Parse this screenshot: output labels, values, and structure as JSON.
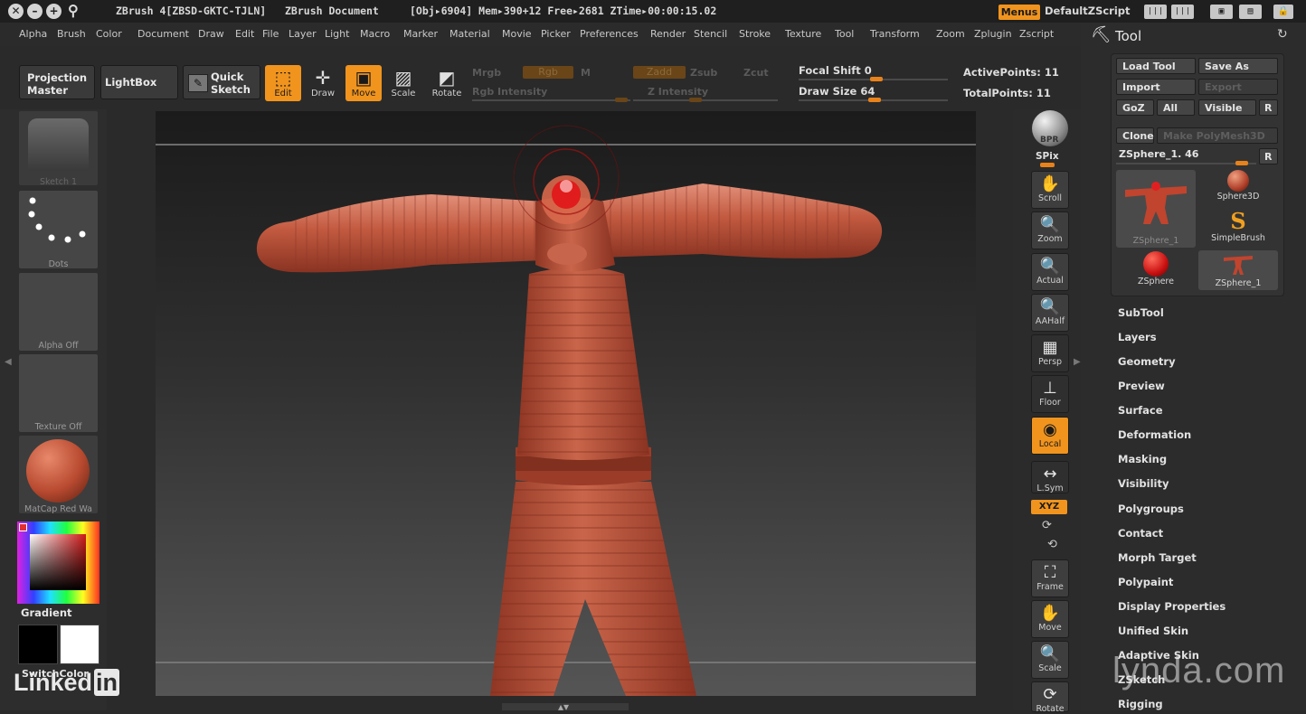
{
  "titlebar": {
    "app": "ZBrush 4[ZBSD-GKTC-TJLN]",
    "document": "ZBrush Document",
    "stats": "[Obj▸6904] Mem▸390+12 Free▸2681 ZTime▸00:00:15.02",
    "menus_label": "Menus",
    "script_label": "DefaultZScript"
  },
  "menubar": [
    "Alpha",
    "Brush",
    "Color",
    "Document",
    "Draw",
    "Edit",
    "File",
    "Layer",
    "Light",
    "Macro",
    "Marker",
    "Material",
    "Movie",
    "Picker",
    "Preferences",
    "Render",
    "Stencil",
    "Stroke",
    "Texture",
    "Tool",
    "Transform",
    "Zoom",
    "Zplugin",
    "Zscript"
  ],
  "shelf": {
    "projection_master": "Projection Master",
    "lightbox": "LightBox",
    "quick_sketch": "Quick Sketch",
    "edit": "Edit",
    "draw": "Draw",
    "move": "Move",
    "scale": "Scale",
    "rotate": "Rotate",
    "mrgb": "Mrgb",
    "rgb": "Rgb",
    "m": "M",
    "rgb_intensity": "Rgb Intensity",
    "zadd": "Zadd",
    "zsub": "Zsub",
    "zcut": "Zcut",
    "z_intensity": "Z Intensity",
    "focal_shift_label": "Focal Shift",
    "focal_shift_value": "0",
    "draw_size_label": "Draw Size",
    "draw_size_value": "64",
    "active_points_label": "ActivePoints:",
    "active_points_value": "11",
    "total_points_label": "TotalPoints:",
    "total_points_value": "11"
  },
  "lefttray": {
    "sketch": "Sketch 1",
    "dots": "Dots",
    "alpha": "Alpha Off",
    "texture": "Texture Off",
    "matcap": "MatCap Red Wa",
    "gradient": "Gradient",
    "switchcolor": "SwitchColor"
  },
  "rightshelf": [
    "BPR",
    "SPix",
    "Scroll",
    "Zoom",
    "Actual",
    "AAHalf",
    "Persp",
    "Floor",
    "Local",
    "L.Sym",
    "XYZ",
    "Frame",
    "Move",
    "Scale",
    "Rotate"
  ],
  "tool": {
    "title": "Tool",
    "load_tool": "Load Tool",
    "save_as": "Save As",
    "import": "Import",
    "export": "Export",
    "goz": "GoZ",
    "all": "All",
    "visible": "Visible",
    "r": "R",
    "clone": "Clone",
    "make_polymesh": "Make PolyMesh3D",
    "current_tool": "ZSphere_1. 46",
    "thumbs": [
      "ZSphere_1",
      "Sphere3D",
      "SimpleBrush",
      "ZSphere",
      "ZSphere_1"
    ],
    "sections": [
      "SubTool",
      "Layers",
      "Geometry",
      "Preview",
      "Surface",
      "Deformation",
      "Masking",
      "Visibility",
      "Polygroups",
      "Contact",
      "Morph Target",
      "Polypaint",
      "Display Properties",
      "Unified Skin",
      "Adaptive Skin",
      "ZSketch",
      "Rigging"
    ]
  },
  "watermarks": {
    "linkedin": "Linked",
    "linkedin_in": "in",
    "lynda": "lynda.com"
  },
  "colors": {
    "accent": "#f0941e",
    "model": "#b8452f"
  }
}
